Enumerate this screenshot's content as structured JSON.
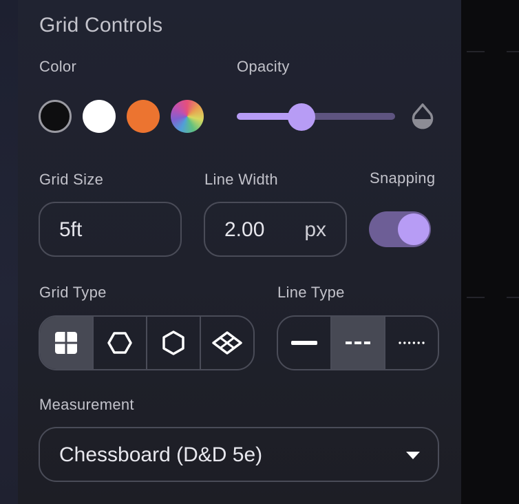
{
  "panel": {
    "title": "Grid Controls",
    "color": {
      "label": "Color",
      "swatches": [
        {
          "name": "black",
          "hex": "#0e0e10",
          "selected": true
        },
        {
          "name": "white",
          "hex": "#ffffff"
        },
        {
          "name": "orange",
          "hex": "#ec7430"
        },
        {
          "name": "custom-rainbow",
          "hex": "multicolor"
        }
      ]
    },
    "opacity": {
      "label": "Opacity",
      "value_fraction": 0.4,
      "icon": "opacity-drop-icon"
    },
    "grid_size": {
      "label": "Grid Size",
      "value": "5ft"
    },
    "line_width": {
      "label": "Line Width",
      "value": "2.00",
      "unit": "px"
    },
    "snapping": {
      "label": "Snapping",
      "enabled": true
    },
    "grid_type": {
      "label": "Grid Type",
      "options": [
        "square-grid-icon",
        "hex-horizontal-icon",
        "hex-vertical-icon",
        "isometric-grid-icon"
      ],
      "selected": 0
    },
    "line_type": {
      "label": "Line Type",
      "options": [
        "solid-line-icon",
        "dashed-line-icon",
        "dotted-line-icon"
      ],
      "selected": 1
    },
    "measurement": {
      "label": "Measurement",
      "value": "Chessboard (D&D 5e)"
    }
  },
  "colors": {
    "accent": "#b79cf5",
    "track": "#5e5480",
    "toggle_track": "#6d5e96",
    "border": "#4a4c58"
  }
}
